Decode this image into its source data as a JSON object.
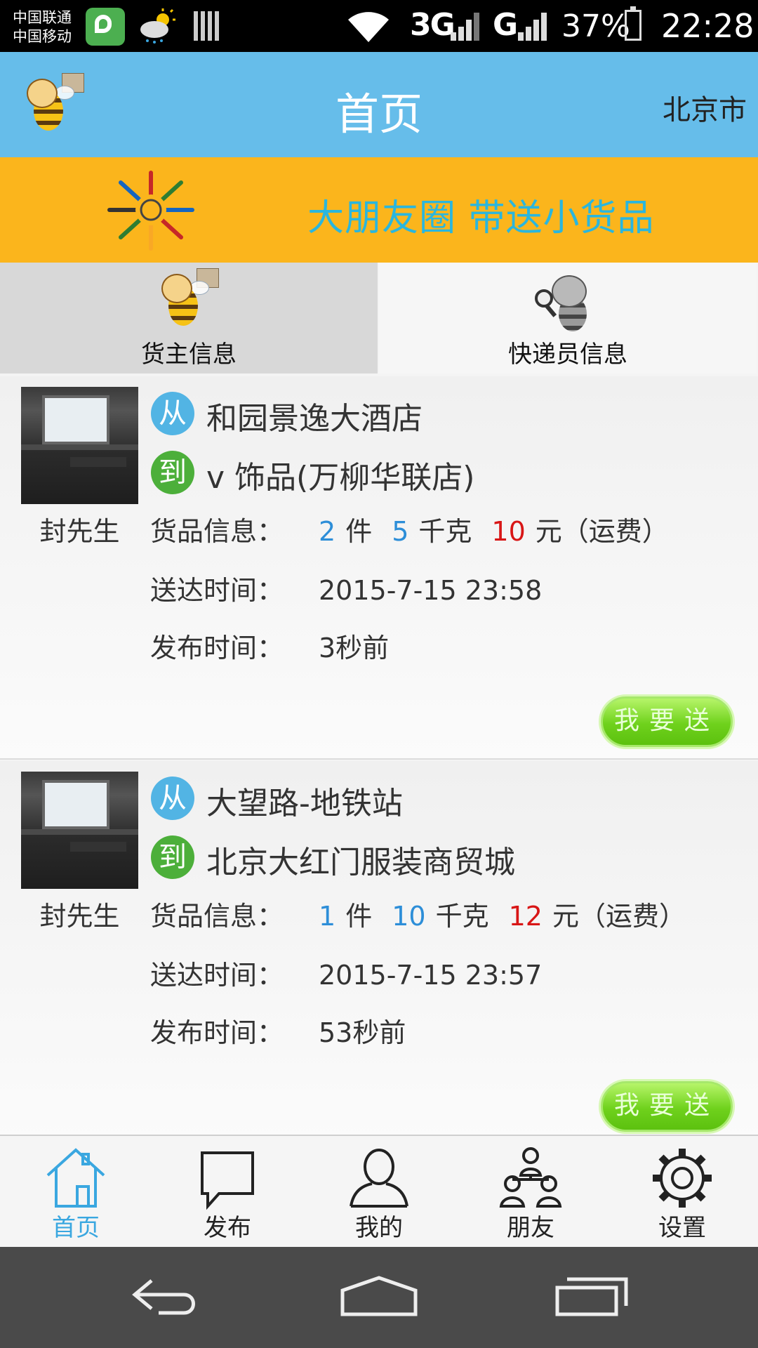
{
  "status_bar": {
    "carrier1": "中国联通",
    "carrier2": "中国移动",
    "net1": "3G",
    "net2": "G",
    "battery": "37%",
    "time": "22:28"
  },
  "header": {
    "title": "首页",
    "city": "北京市"
  },
  "banner": {
    "text": "大朋友圈 带送小货品"
  },
  "tabs": [
    {
      "label": "货主信息",
      "active": true
    },
    {
      "label": "快递员信息",
      "active": false
    }
  ],
  "labels": {
    "from_badge": "从",
    "to_badge": "到",
    "goods_info": "货品信息：",
    "delivery_time": "送达时间：",
    "publish_time": "发布时间：",
    "unit_piece": "件",
    "unit_kg": "千克",
    "unit_fee": "元（运费）",
    "send_button": "我要送"
  },
  "items": [
    {
      "person": "封先生",
      "from": "和园景逸大酒店",
      "to": "v 饰品(万柳华联店)",
      "pieces": "2",
      "weight": "5",
      "fee": "10",
      "delivery_time": "2015-7-15 23:58",
      "publish_time": "3秒前"
    },
    {
      "person": "封先生",
      "from": "大望路-地铁站",
      "to": "北京大红门服装商贸城",
      "pieces": "1",
      "weight": "10",
      "fee": "12",
      "delivery_time": "2015-7-15 23:57",
      "publish_time": "53秒前"
    }
  ],
  "bottom_nav": [
    {
      "label": "首页",
      "icon": "home-icon",
      "active": true
    },
    {
      "label": "发布",
      "icon": "chat-bubble-icon",
      "active": false
    },
    {
      "label": "我的",
      "icon": "person-icon",
      "active": false
    },
    {
      "label": "朋友",
      "icon": "group-icon",
      "active": false
    },
    {
      "label": "设置",
      "icon": "gear-icon",
      "active": false
    }
  ],
  "colors": {
    "header": "#66bdea",
    "banner": "#fbb51c",
    "banner_text": "#2ab6de",
    "accent_blue": "#2d8ed8",
    "accent_red": "#d81616",
    "send_button": "#6fd11c"
  }
}
